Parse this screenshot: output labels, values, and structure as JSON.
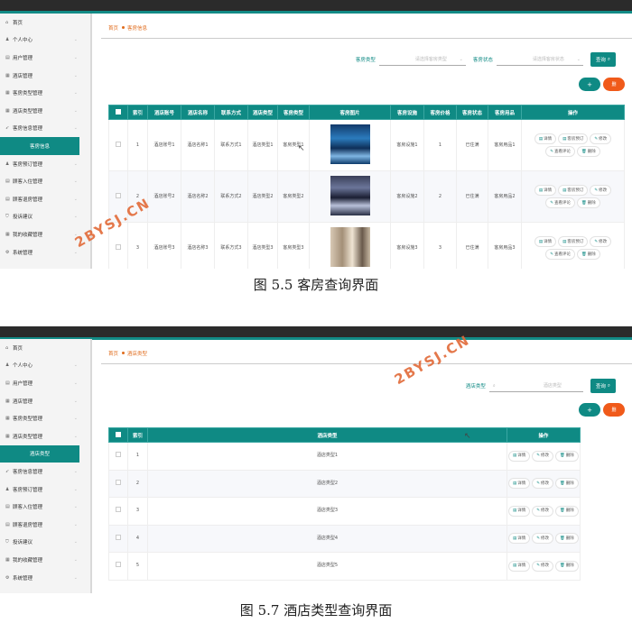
{
  "watermark": "2BYSJ.CN",
  "screen1": {
    "sidebar": [
      {
        "icon": "⌂",
        "label": "首页",
        "chev": false
      },
      {
        "icon": "♟",
        "label": "个人中心",
        "chev": true
      },
      {
        "icon": "▤",
        "label": "用户管理",
        "chev": true
      },
      {
        "icon": "▦",
        "label": "酒店管理",
        "chev": true
      },
      {
        "icon": "▦",
        "label": "客房类型管理",
        "chev": true
      },
      {
        "icon": "▦",
        "label": "酒店类型管理",
        "chev": true
      },
      {
        "icon": "➶",
        "label": "客房信息管理",
        "chev": true
      },
      {
        "icon": "",
        "label": "客房信息",
        "active": true
      },
      {
        "icon": "♟",
        "label": "客房预订管理",
        "chev": true
      },
      {
        "icon": "▤",
        "label": "顾客入住管理",
        "chev": true
      },
      {
        "icon": "▤",
        "label": "顾客退房管理",
        "chev": true
      },
      {
        "icon": "⛉",
        "label": "投诉建议",
        "chev": true
      },
      {
        "icon": "▦",
        "label": "我的收藏管理",
        "chev": true
      },
      {
        "icon": "⚙",
        "label": "系统管理",
        "chev": true
      }
    ],
    "breadcrumb": {
      "home": "首页",
      "current": "客房信息"
    },
    "filters": {
      "label1": "客房类型",
      "placeholder1": "请选择客房类型",
      "label2": "客房状态",
      "placeholder2": "请选择客房状态",
      "query": "查询"
    },
    "buttons": {
      "add": "+",
      "del": "删"
    },
    "columns": [
      "索引",
      "酒店账号",
      "酒店名称",
      "联系方式",
      "酒店类型",
      "客房类型",
      "客房图片",
      "客房设施",
      "客房价格",
      "客房状态",
      "客房用品",
      "操作"
    ],
    "rows": [
      {
        "idx": "1",
        "account": "酒店账号1",
        "name": "酒店名称1",
        "contact": "联系方式1",
        "htype": "酒店类型1",
        "rtype": "客房类型1",
        "facility": "客房设施1",
        "price": "1",
        "status": "已住满",
        "supplies": "客房用品1"
      },
      {
        "idx": "2",
        "account": "酒店账号2",
        "name": "酒店名称2",
        "contact": "联系方式2",
        "htype": "酒店类型2",
        "rtype": "客房类型2",
        "facility": "客房设施2",
        "price": "2",
        "status": "已住满",
        "supplies": "客房用品2"
      },
      {
        "idx": "3",
        "account": "酒店账号3",
        "name": "酒店名称3",
        "contact": "联系方式3",
        "htype": "酒店类型3",
        "rtype": "客房类型3",
        "facility": "客房设施3",
        "price": "3",
        "status": "已住满",
        "supplies": "客房用品3"
      }
    ],
    "actions": {
      "detail": "详情",
      "book": "客房预订",
      "edit": "修改",
      "reviews": "查看评论",
      "delete": "删除"
    }
  },
  "caption1": "图 5.5 客房查询界面",
  "screen2": {
    "sidebar": [
      {
        "icon": "⌂",
        "label": "首页",
        "chev": false
      },
      {
        "icon": "♟",
        "label": "个人中心",
        "chev": true
      },
      {
        "icon": "▤",
        "label": "用户管理",
        "chev": true
      },
      {
        "icon": "▦",
        "label": "酒店管理",
        "chev": true
      },
      {
        "icon": "▦",
        "label": "客房类型管理",
        "chev": true
      },
      {
        "icon": "▦",
        "label": "酒店类型管理",
        "chev": true
      },
      {
        "icon": "",
        "label": "酒店类型",
        "active": true
      },
      {
        "icon": "➶",
        "label": "客房信息管理",
        "chev": true
      },
      {
        "icon": "♟",
        "label": "客房预订管理",
        "chev": true
      },
      {
        "icon": "▤",
        "label": "顾客入住管理",
        "chev": true
      },
      {
        "icon": "▤",
        "label": "顾客退房管理",
        "chev": true
      },
      {
        "icon": "⛉",
        "label": "投诉建议",
        "chev": true
      },
      {
        "icon": "▦",
        "label": "我的收藏管理",
        "chev": true
      },
      {
        "icon": "⚙",
        "label": "系统管理",
        "chev": true
      }
    ],
    "breadcrumb": {
      "home": "首页",
      "current": "酒店类型"
    },
    "filters": {
      "label1": "酒店类型",
      "placeholder1": "酒店类型",
      "query": "查询"
    },
    "buttons": {
      "add": "+",
      "del": "删"
    },
    "columns": [
      "索引",
      "酒店类型",
      "操作"
    ],
    "rows": [
      {
        "idx": "1",
        "htype": "酒店类型1"
      },
      {
        "idx": "2",
        "htype": "酒店类型2"
      },
      {
        "idx": "3",
        "htype": "酒店类型3"
      },
      {
        "idx": "4",
        "htype": "酒店类型4"
      },
      {
        "idx": "5",
        "htype": "酒店类型5"
      }
    ],
    "actions": {
      "detail": "详情",
      "edit": "修改",
      "delete": "删除"
    }
  },
  "caption2": "图 5.7 酒店类型查询界面"
}
